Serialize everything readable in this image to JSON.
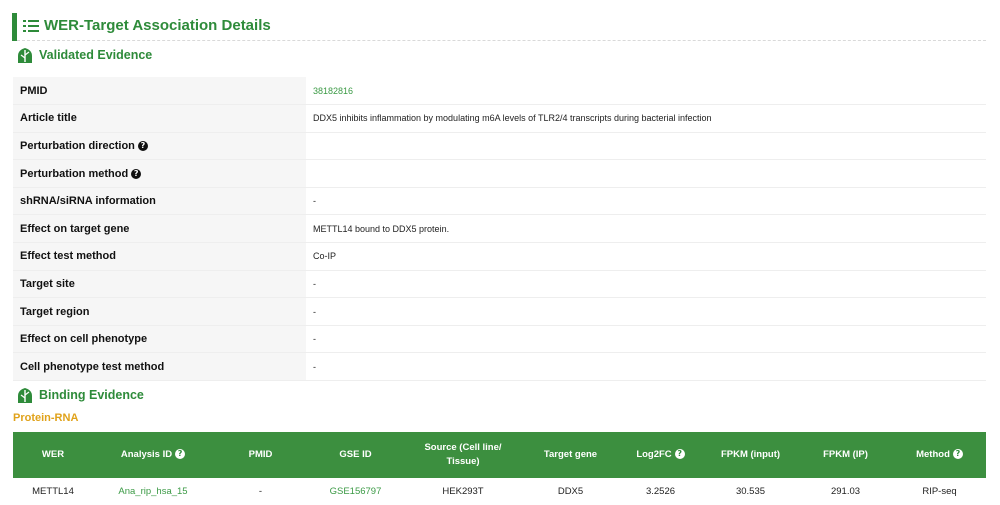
{
  "header": {
    "title": "WER-Target Association Details",
    "icon": "list-icon"
  },
  "validated": {
    "title": "Validated Evidence",
    "icon": "leaf-icon",
    "rows": [
      {
        "label": "PMID",
        "value": "38182816",
        "link": true,
        "help": false
      },
      {
        "label": "Article title",
        "value": "DDX5 inhibits inflammation by modulating m6A levels of TLR2/4 transcripts during bacterial infection",
        "link": false,
        "help": false
      },
      {
        "label": "Perturbation direction",
        "value": "",
        "link": false,
        "help": true
      },
      {
        "label": "Perturbation method",
        "value": "",
        "link": false,
        "help": true
      },
      {
        "label": "shRNA/siRNA information",
        "value": "-",
        "link": false,
        "help": false
      },
      {
        "label": "Effect on target gene",
        "value": "METTL14 bound to DDX5 protein.",
        "link": false,
        "help": false
      },
      {
        "label": "Effect test method",
        "value": "Co-IP",
        "link": false,
        "help": false
      },
      {
        "label": "Target site",
        "value": "-",
        "link": false,
        "help": false
      },
      {
        "label": "Target region",
        "value": "-",
        "link": false,
        "help": false
      },
      {
        "label": "Effect on cell phenotype",
        "value": "-",
        "link": false,
        "help": false
      },
      {
        "label": "Cell phenotype test method",
        "value": "-",
        "link": false,
        "help": false
      }
    ]
  },
  "binding": {
    "title": "Binding Evidence",
    "icon": "leaf-icon",
    "subtitle": "Protein-RNA",
    "columns": [
      {
        "label": "WER",
        "help": false
      },
      {
        "label": "Analysis ID",
        "help": true
      },
      {
        "label": "PMID",
        "help": false
      },
      {
        "label": "GSE ID",
        "help": false
      },
      {
        "label": "Source (Cell line/ Tissue)",
        "help": false
      },
      {
        "label": "Target gene",
        "help": false
      },
      {
        "label": "Log2FC",
        "help": true
      },
      {
        "label": "FPKM (input)",
        "help": false
      },
      {
        "label": "FPKM (IP)",
        "help": false
      },
      {
        "label": "Method",
        "help": true
      }
    ],
    "rows": [
      {
        "cells": [
          {
            "value": "METTL14",
            "link": false
          },
          {
            "value": "Ana_rip_hsa_15",
            "link": true
          },
          {
            "value": "-",
            "link": false
          },
          {
            "value": "GSE156797",
            "link": true
          },
          {
            "value": "HEK293T",
            "link": false
          },
          {
            "value": "DDX5",
            "link": false
          },
          {
            "value": "3.2526",
            "link": false
          },
          {
            "value": "30.535",
            "link": false
          },
          {
            "value": "291.03",
            "link": false
          },
          {
            "value": "RIP-seq",
            "link": false
          }
        ]
      }
    ]
  },
  "help_glyph": "?",
  "colors": {
    "accent": "#2e8b3a",
    "table_header": "#3c8f3f",
    "link": "#3b9a45",
    "sublabel": "#e0a21a"
  }
}
